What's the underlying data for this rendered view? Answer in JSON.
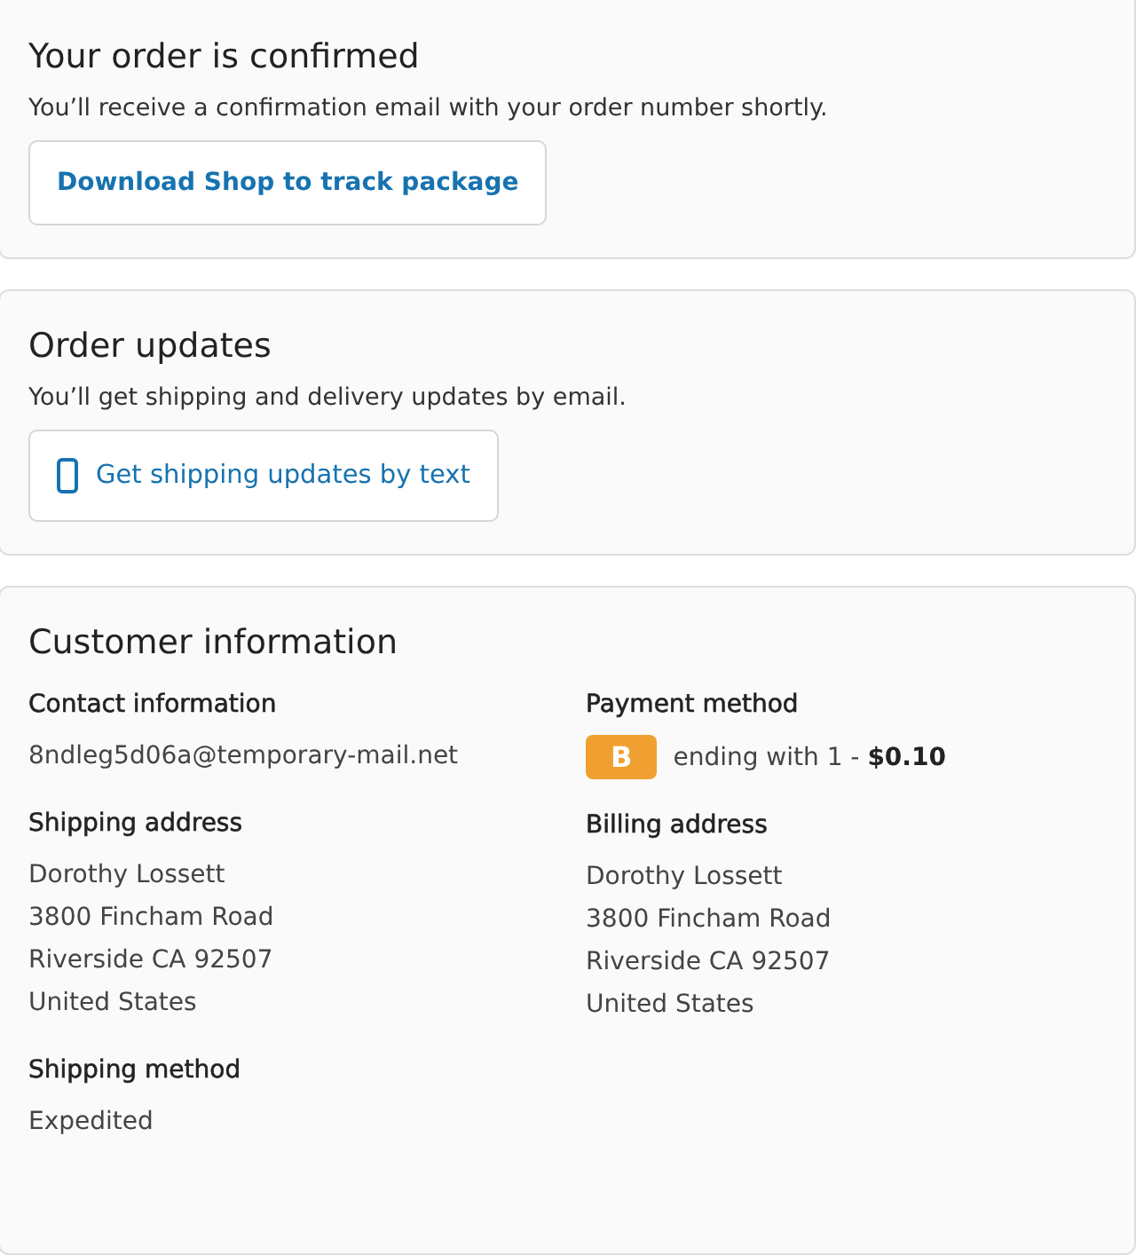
{
  "confirmation": {
    "title": "Your order is confirmed",
    "text": "You’ll receive a confirmation email with your order number shortly.",
    "button": "Download Shop to track package"
  },
  "updates": {
    "title": "Order updates",
    "text": "You’ll get shipping and delivery updates by email.",
    "button": "Get shipping updates by text"
  },
  "customer": {
    "title": "Customer information",
    "columns": [
      [
        {
          "kind": "lines",
          "heading": "Contact information",
          "lines": [
            "8ndleg5d06a@temporary-mail.net"
          ]
        },
        {
          "kind": "lines",
          "heading": "Shipping address",
          "lines": [
            "Dorothy Lossett",
            "3800 Fincham Road",
            "Riverside CA 92507",
            "United States"
          ]
        },
        {
          "kind": "lines",
          "heading": "Shipping method",
          "lines": [
            "Expedited"
          ]
        }
      ],
      [
        {
          "kind": "payment",
          "heading": "Payment method",
          "badge": "B",
          "text": "ending with 1 - **$0.10**"
        },
        {
          "kind": "lines",
          "heading": "Billing address",
          "lines": [
            "Dorothy Lossett",
            "3800 Fincham Road",
            "Riverside CA 92507",
            "United States"
          ]
        }
      ]
    ]
  }
}
